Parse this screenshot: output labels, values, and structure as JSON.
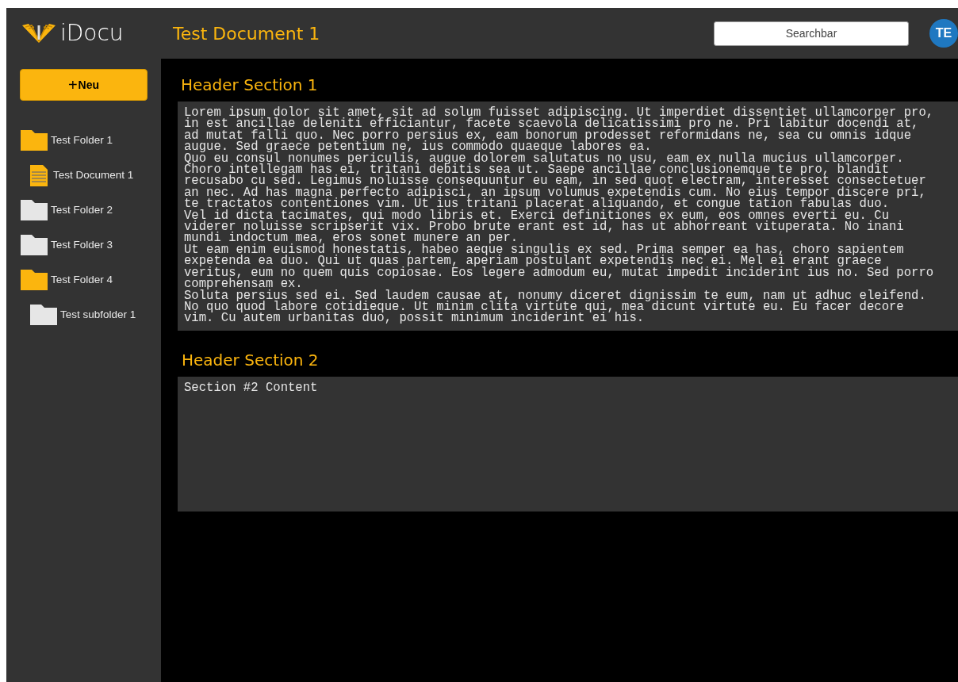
{
  "app": {
    "name": "iDocu"
  },
  "document_title": "Test Document 1",
  "search": {
    "placeholder": "Searchbar"
  },
  "avatar": {
    "initials": "TE"
  },
  "new_button": {
    "icon": "+",
    "label": "Neu"
  },
  "tree": [
    {
      "kind": "folder",
      "label": "Test Folder 1",
      "expanded": true,
      "children": [
        {
          "kind": "document",
          "label": "Test Document 1",
          "selected": true
        }
      ]
    },
    {
      "kind": "folder",
      "label": "Test Folder 2",
      "expanded": false
    },
    {
      "kind": "folder",
      "label": "Test Folder 3",
      "expanded": false
    },
    {
      "kind": "folder",
      "label": "Test Folder 4",
      "expanded": true,
      "children": [
        {
          "kind": "folder",
          "label": "Test subfolder 1",
          "expanded": false
        }
      ]
    }
  ],
  "sections": [
    {
      "header": "Header Section 1",
      "paragraphs": [
        "Lorem ipsum dolor sit amet, sit ad solum fuisset adipiscing. Ut imperdiet dissentiet ullamcorper pro, in est ancillae deleniti efficiantur, facete scaevola delicatissimi pro ne. Pri labitur docendi at, ad mutat falli quo. Nec porro persius ex, eam bonorum prodesset reformidans ne, sea cu omnis idque augue. Sed graece petentium ne, ius commodo quaeque labores ea.",
        "Quo eu consul nonumes periculis, augue dolorem salutatus no usu, eam ex nulla mucius ullamcorper. Choro intellegam has ei, tritani debitis sea ut. Saepe ancillae conclusionemque te pro, blandit recusabo cu sed. Legimus noluisse consequuntur eu eam, in sed quot electram, interesset consectetuer an nec. Ad has magna perfecto adipisci, an ipsum volumus expetendis cum. No eius tempor discere pri, te tractatos contentiones vim. Ut ius tritani placerat aliquando, et congue tation fabulas duo.",
        "Vel id dicta tacimates, qui modo libris et. Exerci definitiones ex eum, eos omnes everti eu. Cu viderer noluisse scripserit vix. Probo brute erant est id, has ut abhorreant vituperata. No inani mundi indoctum mea, eros sonet munere an per.",
        "Ut eam enim euismod honestatis, habeo aeque singulis ex sed. Prima semper ea has, choro sapientem expetenda ea duo. Qui ut quas partem, aperiam postulant expetendis nec ei. Mel ei erant graece veritus, eum no quem quis copiosae. Eos legere admodum eu, mutat impedit inciderint ius no. Sed porro comprehensam ex.",
        "Soluta persius sed ei. Sed laudem causae at, nonumy diceret dignissim te eum, nam ut adhuc eleifend. No quo quod labore cotidieque. Ut minim clita virtute qui, mea dicunt virtute eu. Eu facer decore vim. Cu autem urbanitas duo, possit minimum inciderint ei his."
      ]
    },
    {
      "header": "Header Section 2",
      "paragraphs": [
        "Section #2 Content"
      ]
    }
  ]
}
